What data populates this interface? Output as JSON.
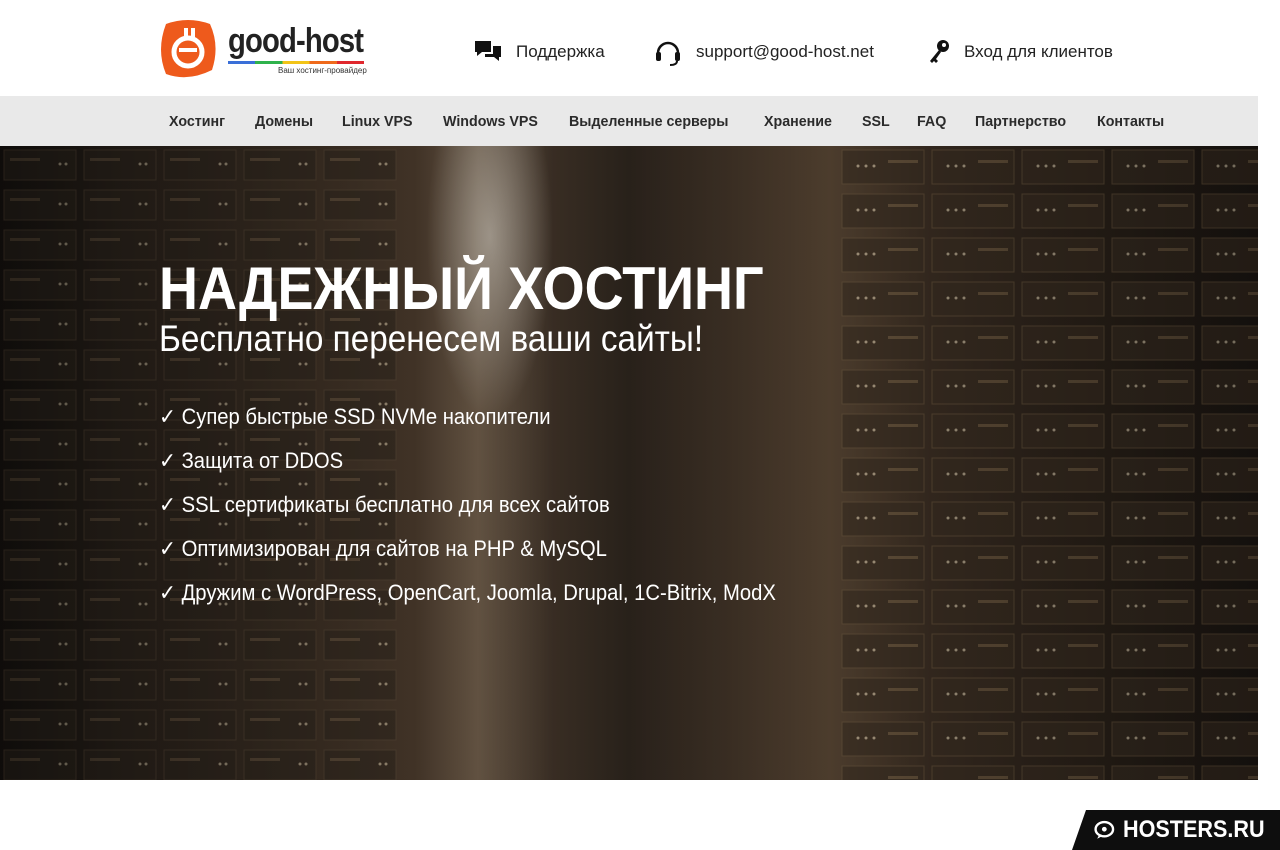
{
  "logo": {
    "name": "good-host",
    "tagline": "Ваш хостинг-провайдер",
    "brand_color": "#ee5a1c"
  },
  "header_links": {
    "support": {
      "label": "Поддержка",
      "icon": "chat-bubbles-icon"
    },
    "email": {
      "label": "support@good-host.net",
      "icon": "headset-icon"
    },
    "login": {
      "label": "Вход для клиентов",
      "icon": "key-icon"
    }
  },
  "nav": {
    "items": [
      "Хостинг",
      "Домены",
      "Linux VPS",
      "Windows VPS",
      "Выделенные серверы",
      "Хранение",
      "SSL",
      "FAQ",
      "Партнерство",
      "Контакты"
    ]
  },
  "hero": {
    "title": "НАДЕЖНЫЙ ХОСТИНГ",
    "subtitle": "Бесплатно перенесем ваши сайты!",
    "features": [
      "✓ Супер быстрые SSD NVMe накопители",
      "✓ Защита от DDOS",
      "✓ SSL сертификаты бесплатно для всех сайтов",
      "✓ Оптимизирован для сайтов на PHP & MySQL",
      "✓ Дружим с WordPress, OpenCart, Joomla, Drupal, 1C-Bitrix, ModX"
    ]
  },
  "watermark": {
    "text": "HOSTERS.RU",
    "icon": "speech-bubble-icon"
  }
}
